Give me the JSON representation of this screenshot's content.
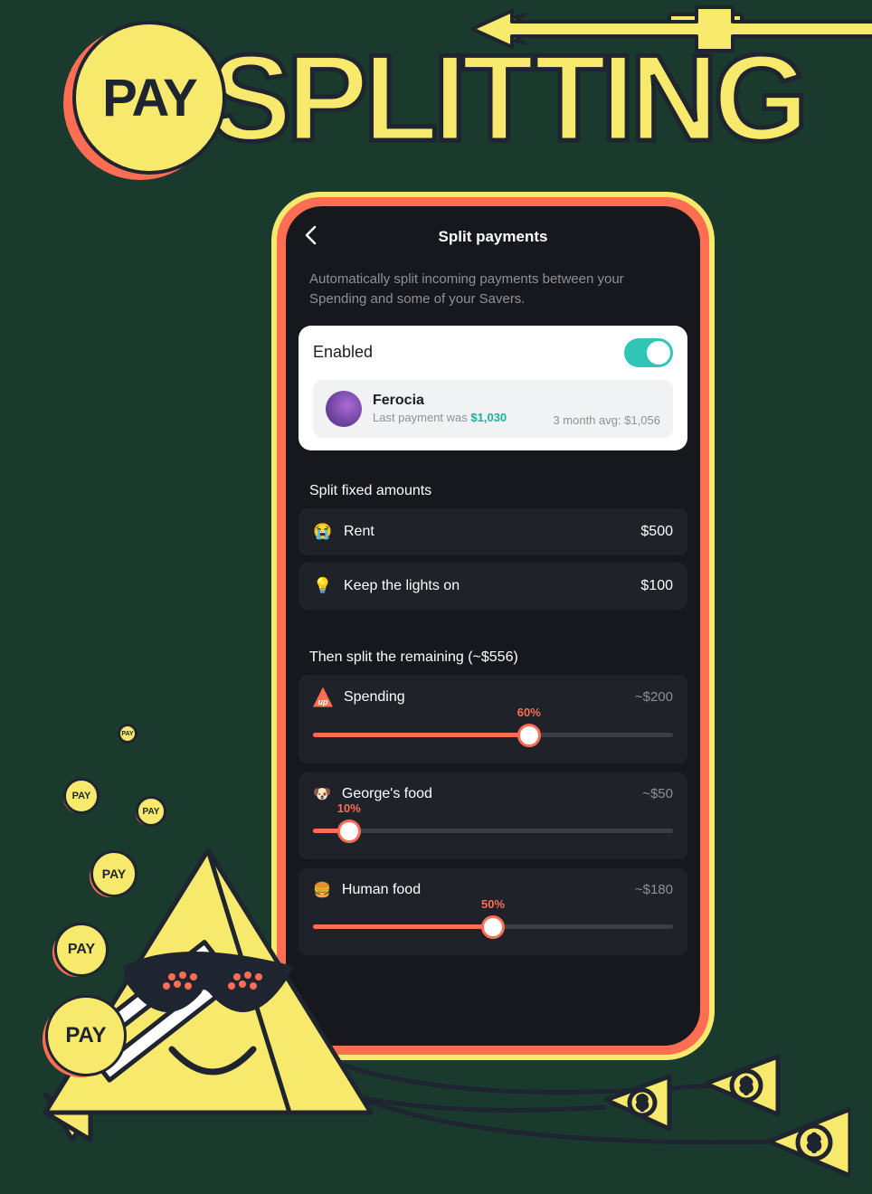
{
  "hero": {
    "coin_label": "PAY",
    "word": "SPLITTING"
  },
  "screen": {
    "title": "Split payments",
    "description": "Automatically split incoming payments between your Spending and some of your Savers.",
    "enabled_label": "Enabled",
    "enabled": true,
    "payer": {
      "name": "Ferocia",
      "last_prefix": "Last payment was ",
      "last_amount": "$1,030",
      "avg_label": "3 month avg: $1,056"
    },
    "fixed": {
      "title": "Split fixed amounts",
      "items": [
        {
          "emoji": "😭",
          "label": "Rent",
          "amount": "$500"
        },
        {
          "emoji": "💡",
          "label": "Keep the lights on",
          "amount": "$100"
        }
      ]
    },
    "remaining": {
      "title": "Then split the remaining (~$556)",
      "items": [
        {
          "icon": "up",
          "label": "Spending",
          "approx": "~$200",
          "pct": 60
        },
        {
          "emoji": "🐶",
          "label": "George's food",
          "approx": "~$50",
          "pct": 10
        },
        {
          "emoji": "🍔",
          "label": "Human food",
          "approx": "~$180",
          "pct": 50
        }
      ]
    }
  }
}
